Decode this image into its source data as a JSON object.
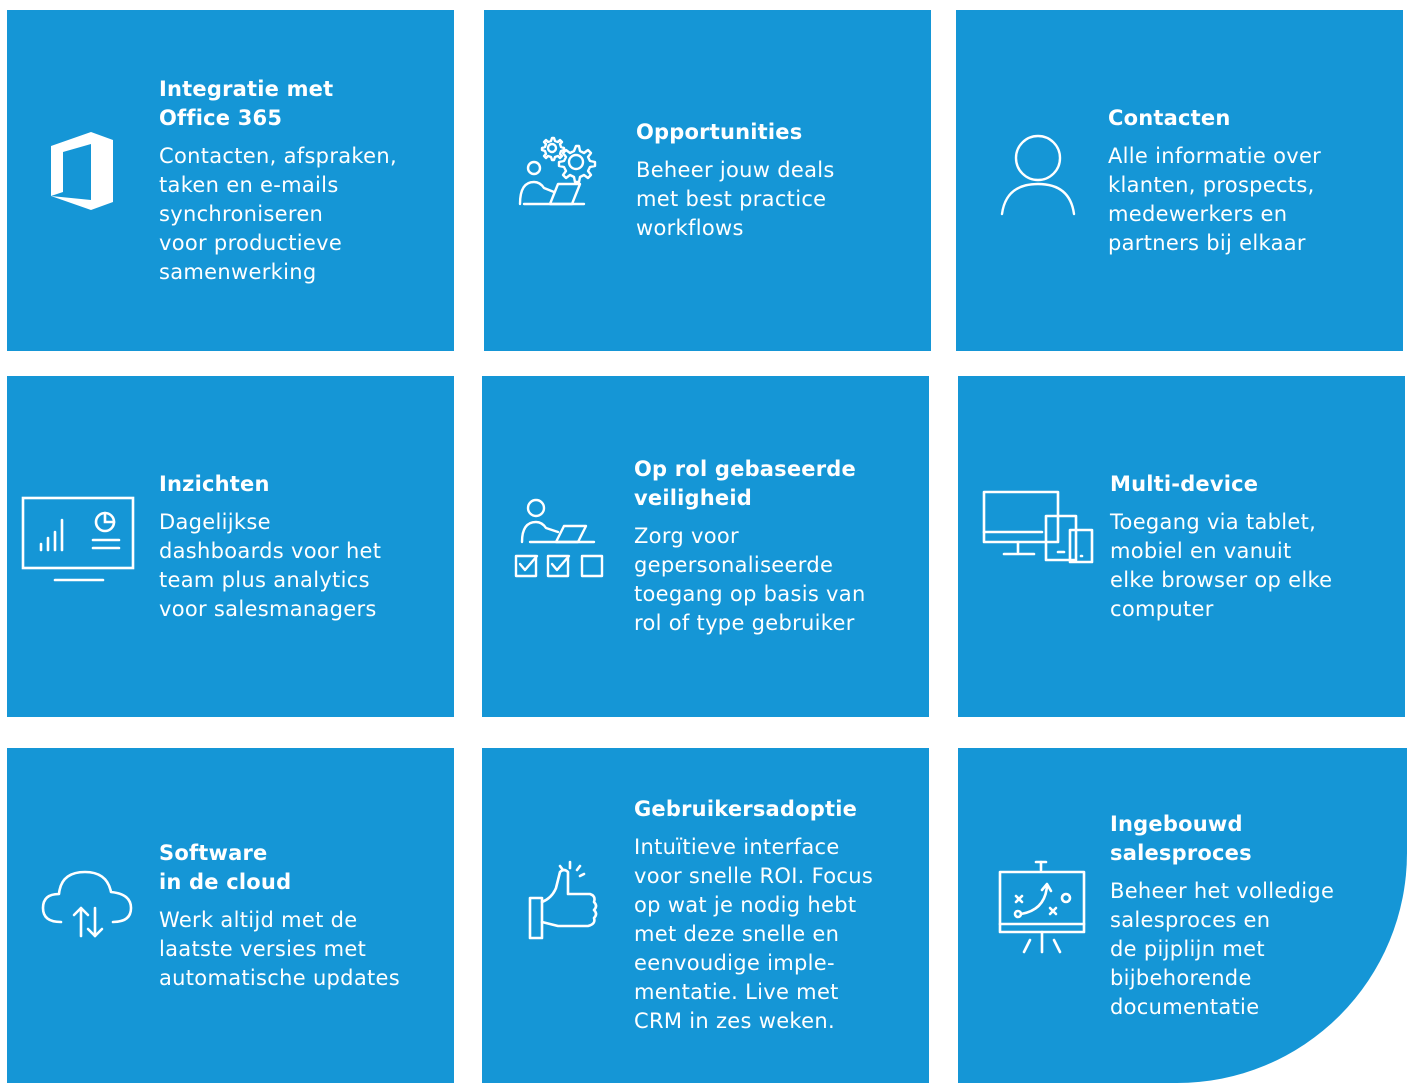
{
  "tiles": [
    {
      "title": "Integratie met\nOffice 365",
      "description": "Contacten, afspraken,\ntaken en e-mails\nsynchroniseren\nvoor productieve\nsamenwerking",
      "icon": "office-365-icon"
    },
    {
      "title": "Opportunities",
      "description": "Beheer jouw deals\nmet best practice\nworkflows",
      "icon": "person-gears-icon"
    },
    {
      "title": "Contacten",
      "description": "Alle informatie over\nklanten, prospects,\nmedewerkers en\npartners bij elkaar",
      "icon": "user-icon"
    },
    {
      "title": "Inzichten",
      "description": "Dagelijkse\ndashboards voor het\nteam plus analytics\nvoor salesmanagers",
      "icon": "dashboard-monitor-icon"
    },
    {
      "title": "Op rol gebaseerde\nveiligheid",
      "description": "Zorg voor\ngepersonaliseerde\ntoegang op basis van\nrol of type gebruiker",
      "icon": "person-checkboxes-icon"
    },
    {
      "title": "Multi-device",
      "description": "Toegang via tablet,\nmobiel en vanuit\nelke browser op elke\ncomputer",
      "icon": "devices-icon"
    },
    {
      "title": "Software\nin de cloud",
      "description": "Werk altijd met de\nlaatste versies met\nautomatische updates",
      "icon": "cloud-sync-icon"
    },
    {
      "title": "Gebruikersadoptie",
      "description": "Intuïtieve interface\nvoor snelle ROI. Focus\nop wat je nodig hebt\nmet deze snelle en\neenvoudige imple-\nmentatie. Live met\nCRM in zes weken.",
      "icon": "thumbs-up-icon"
    },
    {
      "title": "Ingebouwd\nsalesproces",
      "description": "Beheer het volledige\nsalesproces en\nde pijplijn met\nbijbehorende\ndocumentatie",
      "icon": "strategy-board-icon"
    }
  ],
  "colors": {
    "tile": "#1596d6",
    "text": "#ffffff"
  }
}
